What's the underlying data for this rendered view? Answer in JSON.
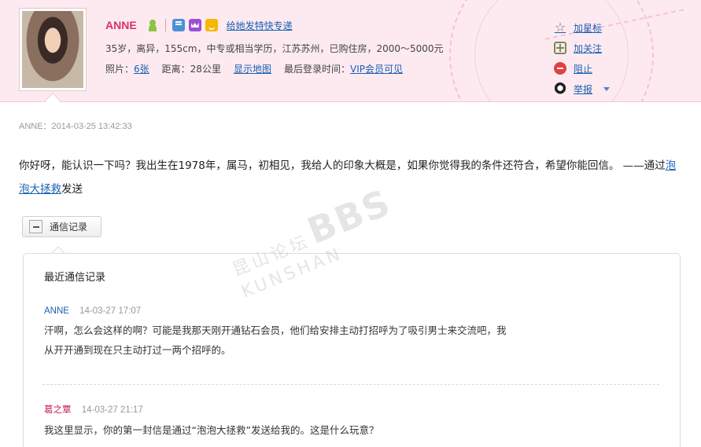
{
  "profile": {
    "name": "ANNE",
    "express_link": "给她发特快专递",
    "info": "35岁，离异，155cm，中专或相当学历，江苏苏州，已购住房，2000～5000元",
    "photos_label": "照片：",
    "photos_value": "6张",
    "distance_label": "距离：",
    "distance_value": "28公里",
    "map_link": "显示地图",
    "last_login_label": "最后登录时间：",
    "last_login_value": "VIP会员可见",
    "icons": [
      "person-icon",
      "message-icon",
      "crown-icon",
      "smile-icon"
    ]
  },
  "actions": {
    "star": "加星标",
    "follow": "加关注",
    "block": "阻止",
    "report": "举报"
  },
  "letter": {
    "meta": "ANNE：2014-03-25 13:42:33",
    "body": "你好呀，能认识一下吗？我出生在1978年，属马，初相见，我给人的印象大概是，如果你觉得我的条件还符合，希望你能回信。 ——通过",
    "via_link": "泡泡大拯救",
    "via_suffix": "发送"
  },
  "toggle": {
    "label": "通信记录"
  },
  "history": {
    "title": "最近通信记录",
    "messages": [
      {
        "sender": "ANNE",
        "time": "14-03-27 17:07",
        "line1": "汗啊，怎么会这样的啊？可能是我那天刚开通钻石会员，他们给安排主动打招呼为了吸引男士来交流吧，我",
        "line2": "从开开通到现在只主动打过一两个招呼的。"
      },
      {
        "sender": "葛之覃",
        "time": "14-03-27 21:17",
        "line1": "我这里显示，你的第一封信是通过“泡泡大拯救”发送给我的。这是什么玩意？"
      }
    ]
  },
  "watermark": {
    "cn": "昆山论坛",
    "bbs": "BBS",
    "en": "KUNSHAN"
  },
  "colors": {
    "header_bg": "#fdeaf0",
    "link": "#1a5fb4",
    "name": "#d6336c"
  }
}
